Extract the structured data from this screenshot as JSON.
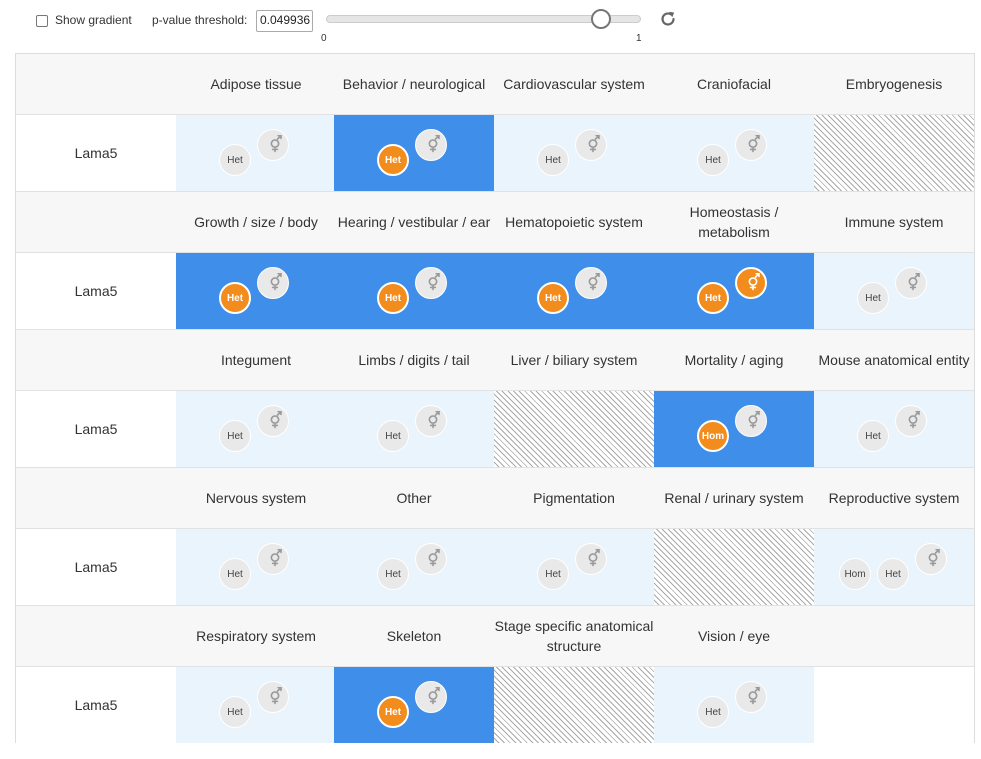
{
  "controls": {
    "show_gradient_label": "Show gradient",
    "pvalue_label": "p-value threshold:",
    "pvalue_value": "0.049936",
    "slider_min_label": "0",
    "slider_max_label": "1",
    "slider_value": 0.8514,
    "refresh_icon": "refresh-icon"
  },
  "colors": {
    "significant_cell": "#3f8fea",
    "tested_cell": "#eaf4fd",
    "significant_badge": "#f28c1c",
    "badge": "#e9e9e9"
  },
  "grid": {
    "gene": "Lama5",
    "rows": [
      {
        "systems": [
          "Adipose tissue",
          "Behavior / neurological",
          "Cardiovascular system",
          "Craniofacial",
          "Embryogenesis"
        ],
        "cells": [
          {
            "state": "tested",
            "zyg": [
              "Het"
            ],
            "sig": false
          },
          {
            "state": "significant",
            "zyg": [
              "Het"
            ],
            "sig": true
          },
          {
            "state": "tested",
            "zyg": [
              "Het"
            ],
            "sig": false
          },
          {
            "state": "tested",
            "zyg": [
              "Het"
            ],
            "sig": false
          },
          {
            "state": "untested"
          }
        ]
      },
      {
        "systems": [
          "Growth / size / body",
          "Hearing / vestibular / ear",
          "Hematopoietic system",
          "Homeostasis / metabolism",
          "Immune system"
        ],
        "cells": [
          {
            "state": "significant",
            "zyg": [
              "Het"
            ],
            "sig": true
          },
          {
            "state": "significant",
            "zyg": [
              "Het"
            ],
            "sig": true
          },
          {
            "state": "significant",
            "zyg": [
              "Het"
            ],
            "sig": true
          },
          {
            "state": "significant",
            "zyg": [
              "Het"
            ],
            "sig": true,
            "sex_sig": true
          },
          {
            "state": "tested",
            "zyg": [
              "Het"
            ],
            "sig": false
          }
        ]
      },
      {
        "systems": [
          "Integument",
          "Limbs / digits / tail",
          "Liver / biliary system",
          "Mortality / aging",
          "Mouse anatomical entity"
        ],
        "cells": [
          {
            "state": "tested",
            "zyg": [
              "Het"
            ],
            "sig": false
          },
          {
            "state": "tested",
            "zyg": [
              "Het"
            ],
            "sig": false
          },
          {
            "state": "untested"
          },
          {
            "state": "significant",
            "zyg": [
              "Hom"
            ],
            "sig": true
          },
          {
            "state": "tested",
            "zyg": [
              "Het"
            ],
            "sig": false
          }
        ]
      },
      {
        "systems": [
          "Nervous system",
          "Other",
          "Pigmentation",
          "Renal / urinary system",
          "Reproductive system"
        ],
        "cells": [
          {
            "state": "tested",
            "zyg": [
              "Het"
            ],
            "sig": false
          },
          {
            "state": "tested",
            "zyg": [
              "Het"
            ],
            "sig": false
          },
          {
            "state": "tested",
            "zyg": [
              "Het"
            ],
            "sig": false
          },
          {
            "state": "untested"
          },
          {
            "state": "tested",
            "zyg": [
              "Hom",
              "Het"
            ],
            "sig": false
          }
        ]
      },
      {
        "systems": [
          "Respiratory system",
          "Skeleton",
          "Stage specific anatomical structure",
          "Vision / eye",
          ""
        ],
        "cells": [
          {
            "state": "tested",
            "zyg": [
              "Het"
            ],
            "sig": false
          },
          {
            "state": "significant",
            "zyg": [
              "Het"
            ],
            "sig": true
          },
          {
            "state": "untested"
          },
          {
            "state": "tested",
            "zyg": [
              "Het"
            ],
            "sig": false
          },
          {
            "state": "empty"
          }
        ]
      }
    ]
  }
}
